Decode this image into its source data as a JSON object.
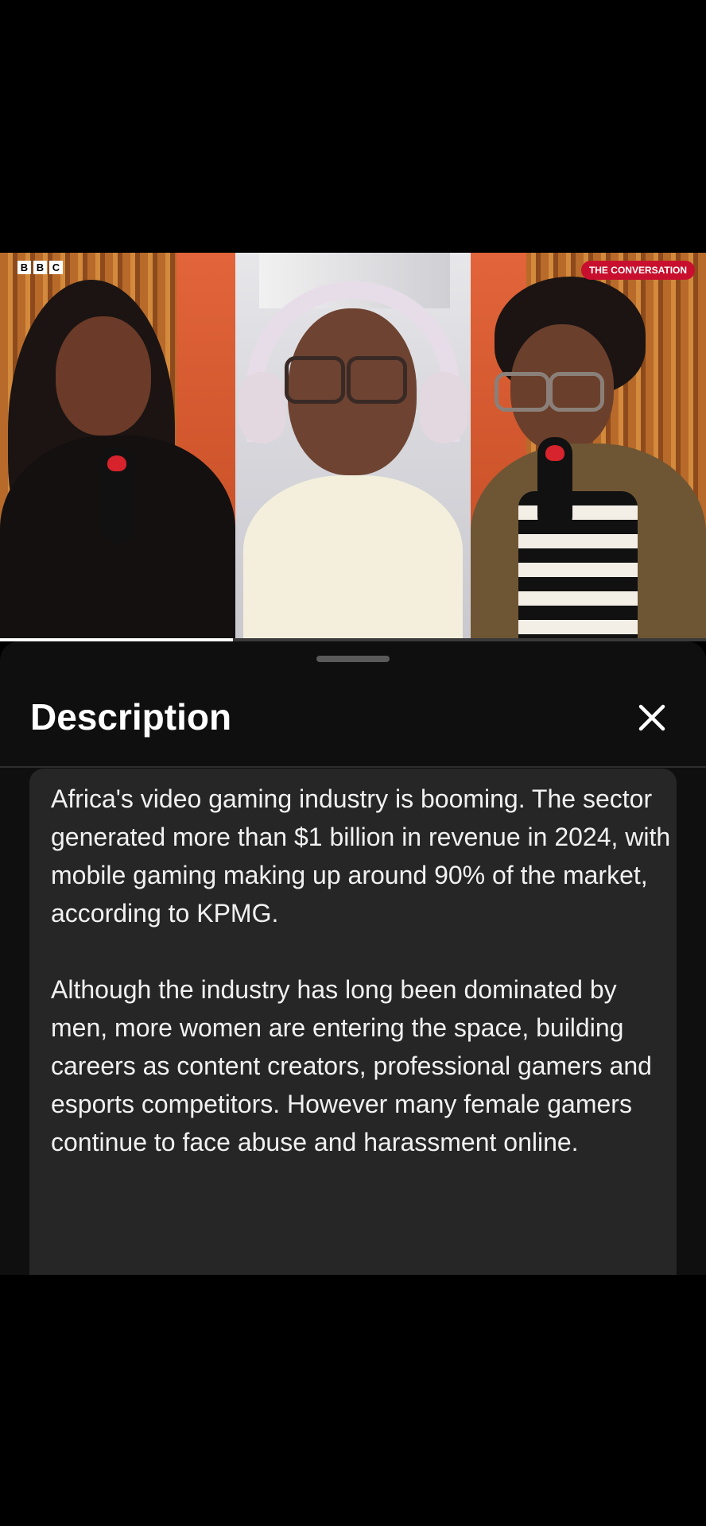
{
  "video": {
    "logo_left": [
      "B",
      "B",
      "C"
    ],
    "logo_right": "THE CONVERSATION",
    "progress": 0.33
  },
  "sheet": {
    "title": "Description",
    "close_icon": "close-icon",
    "description": "Africa's video gaming industry is booming. The sector generated more than $1 billion in revenue in 2024, with mobile gaming making up around 90% of the market, according to KPMG.\n\nAlthough the industry has long been dominated by men, more women are entering the space, building careers as content creators, professional gamers and esports competitors. However many female gamers continue to face abuse and harassment online."
  },
  "colors": {
    "background": "#000000",
    "sheet": "#0f0f0f",
    "card": "#262626",
    "accent_red": "#c8102e"
  }
}
